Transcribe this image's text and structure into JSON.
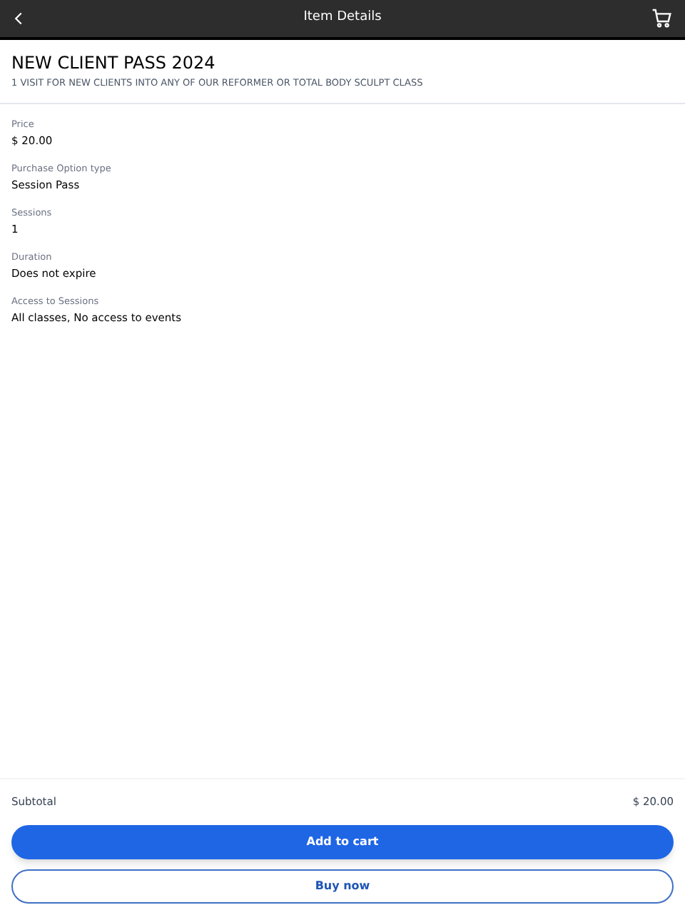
{
  "header": {
    "title": "Item Details"
  },
  "item": {
    "name": "NEW CLIENT PASS 2024",
    "description": "1 VISIT FOR NEW CLIENTS INTO ANY OF OUR REFORMER OR TOTAL BODY SCULPT CLASS"
  },
  "details": [
    {
      "label": "Price",
      "value": "$ 20.00"
    },
    {
      "label": "Purchase Option type",
      "value": "Session Pass"
    },
    {
      "label": "Sessions",
      "value": "1"
    },
    {
      "label": "Duration",
      "value": "Does not expire"
    },
    {
      "label": "Access to Sessions",
      "value": "All classes, No access to events"
    }
  ],
  "footer": {
    "subtotal_label": "Subtotal",
    "subtotal_value": "$ 20.00",
    "buttons": [
      {
        "label": "Add to cart",
        "kind": "primary"
      },
      {
        "label": "Buy now",
        "kind": "outline"
      }
    ]
  }
}
